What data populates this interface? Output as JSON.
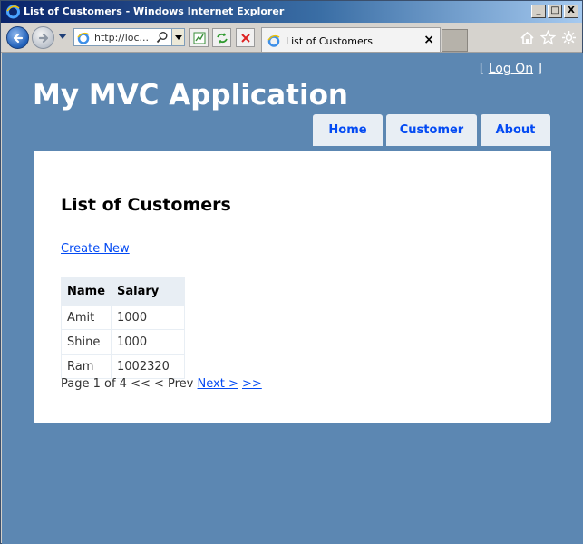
{
  "window": {
    "title": "List of Customers - Windows Internet Explorer",
    "controls": [
      "_",
      "□",
      "X"
    ]
  },
  "toolbar": {
    "address": "http://loc...",
    "tab_label": "List of Customers",
    "tab_close": "×"
  },
  "header": {
    "login_open": "[ ",
    "login_link": "Log On",
    "login_close": " ]",
    "app_title": "My MVC Application",
    "menu": [
      "Home",
      "Customer",
      "About"
    ]
  },
  "main": {
    "heading": "List of Customers",
    "create_new": "Create New",
    "table": {
      "columns": [
        "Name",
        "Salary"
      ],
      "rows": [
        [
          "Amit",
          "1000"
        ],
        [
          "Shine",
          "1000"
        ],
        [
          "Ram",
          "1002320"
        ]
      ]
    },
    "pager": {
      "status": "Page 1 of 4 << < Prev",
      "next": "Next >",
      "last": ">>"
    }
  },
  "colors": {
    "page_background": "#5c87b2",
    "menu_tab": "#e8eef4",
    "link": "#034af3"
  }
}
